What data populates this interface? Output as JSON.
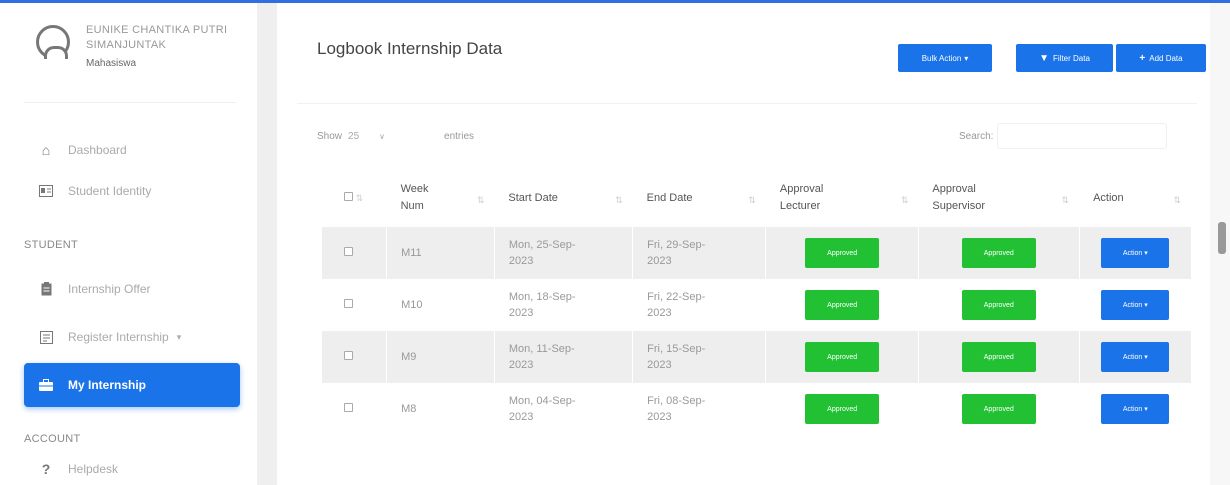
{
  "user": {
    "name": "EUNIKE CHANTIKA PUTRI SIMANJUNTAK",
    "role": "Mahasiswa"
  },
  "nav": {
    "dashboard": "Dashboard",
    "student_identity": "Student Identity",
    "section_student": "STUDENT",
    "internship_offer": "Internship Offer",
    "register_internship": "Register Internship",
    "my_internship": "My Internship",
    "section_account": "ACCOUNT",
    "helpdesk": "Helpdesk"
  },
  "page": {
    "title": "Logbook Internship Data",
    "bulk_action": "Bulk Action",
    "filter_data": "Filter Data",
    "add_data": "Add Data"
  },
  "table_controls": {
    "show_label": "Show",
    "page_length": "25",
    "entries_label": "entries",
    "search_label": "Search:"
  },
  "table": {
    "headers": {
      "week_num": "Week Num",
      "start_date": "Start Date",
      "end_date": "End Date",
      "approval_lecturer": "Approval Lecturer",
      "approval_supervisor": "Approval Supervisor",
      "action": "Action"
    },
    "rows": [
      {
        "week": "M11",
        "start": "Mon, 25-Sep-2023",
        "end": "Fri, 29-Sep-2023",
        "lecturer": "Approved",
        "supervisor": "Approved",
        "action": "Action"
      },
      {
        "week": "M10",
        "start": "Mon, 18-Sep-2023",
        "end": "Fri, 22-Sep-2023",
        "lecturer": "Approved",
        "supervisor": "Approved",
        "action": "Action"
      },
      {
        "week": "M9",
        "start": "Mon, 11-Sep-2023",
        "end": "Fri, 15-Sep-2023",
        "lecturer": "Approved",
        "supervisor": "Approved",
        "action": "Action"
      },
      {
        "week": "M8",
        "start": "Mon, 04-Sep-2023",
        "end": "Fri, 08-Sep-2023",
        "lecturer": "Approved",
        "supervisor": "Approved",
        "action": "Action"
      }
    ]
  },
  "colors": {
    "primary": "#1a73e8",
    "success": "#22c134",
    "stripe": "#eeeeee"
  }
}
